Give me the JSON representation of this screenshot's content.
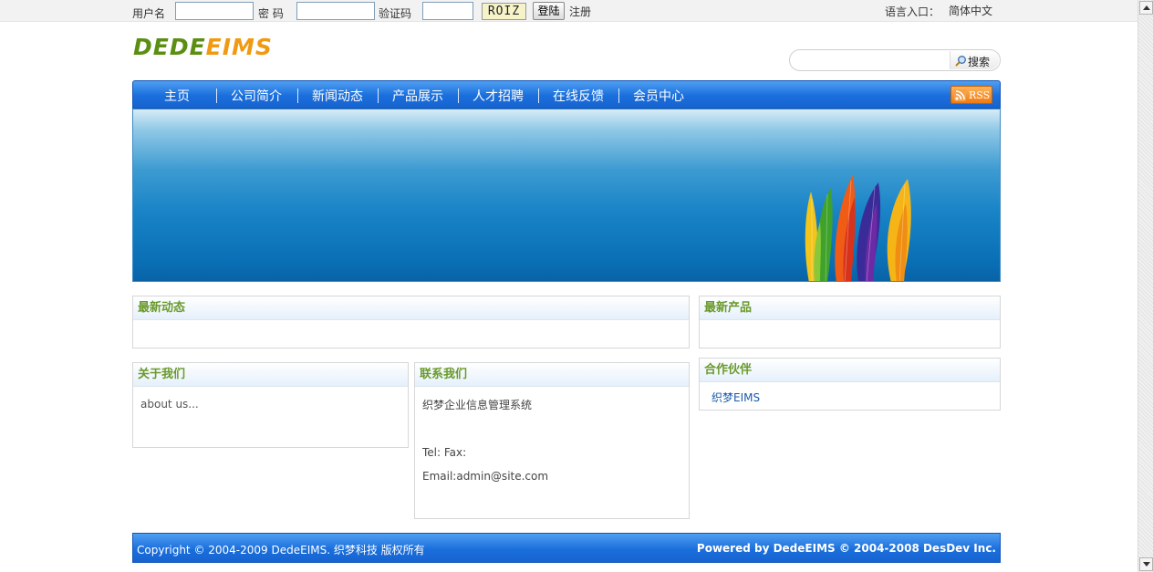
{
  "topbar": {
    "username_label": "用户名",
    "username_value": "",
    "password_label": "密 码",
    "password_value": "",
    "captcha_label": "验证码",
    "captcha_value": "",
    "captcha_image_text": "ROIZ",
    "login_button": "登陆",
    "register_link": "注册",
    "language_label": "语言入口：",
    "language_link": "简体中文"
  },
  "header": {
    "logo_part1": "DEDE",
    "logo_part2": "EIMS",
    "search_placeholder": "",
    "search_button": "搜索"
  },
  "nav": {
    "items": [
      "主页",
      "公司简介",
      "新闻动态",
      "产品展示",
      "人才招聘",
      "在线反馈",
      "会员中心"
    ],
    "rss_label": "RSS"
  },
  "sections": {
    "latest_news_title": "最新动态",
    "latest_products_title": "最新产品",
    "about_title": "关于我们",
    "about_text": "about us...",
    "contact_title": "联系我们",
    "contact_company": "织梦企业信息管理系统",
    "contact_tel": "Tel: Fax:",
    "contact_email": "Email:admin@site.com",
    "partners_title": "合作伙伴",
    "partner_link": "织梦EIMS"
  },
  "footer": {
    "copyright": "Copyright © 2004-2009 DedeEIMS. 织梦科技 版权所有",
    "powered_by": "Powered by DedeEIMS © 2004-2008 DesDev Inc."
  },
  "colors": {
    "nav_blue": "#1a6fdc",
    "section_title_green": "#6a9a2c",
    "logo_green": "#5a8f12",
    "logo_orange": "#f09a12",
    "banner_blue": "#1883c6"
  }
}
